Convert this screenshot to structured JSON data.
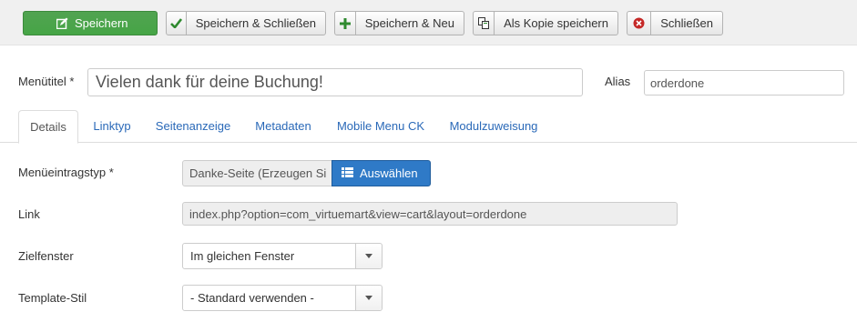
{
  "toolbar": {
    "save_label": "Speichern",
    "save_close_label": "Speichern & Schließen",
    "save_new_label": "Speichern & Neu",
    "save_copy_label": "Als Kopie speichern",
    "close_label": "Schließen",
    "icons": {
      "save": "edit-icon",
      "save_close": "check-icon",
      "save_new": "plus-icon",
      "save_copy": "copy-icon",
      "close": "cancel-icon"
    },
    "colors": {
      "primary": "#46a546",
      "close_icon": "#c52827",
      "check_icon": "#2f8a2f"
    }
  },
  "form": {
    "title_label": "Menütitel *",
    "title_value": "Vielen dank für deine Buchung!",
    "alias_label": "Alias",
    "alias_value": "orderdone"
  },
  "tabs": [
    {
      "label": "Details",
      "active": true
    },
    {
      "label": "Linktyp"
    },
    {
      "label": "Seitenanzeige"
    },
    {
      "label": "Metadaten"
    },
    {
      "label": "Mobile Menu CK"
    },
    {
      "label": "Modulzuweisung"
    }
  ],
  "details": {
    "menu_type_label": "Menüeintragstyp *",
    "menu_type_value": "Danke-Seite (Erzeugen Si",
    "select_button_label": "Auswählen",
    "link_label": "Link",
    "link_value": "index.php?option=com_virtuemart&view=cart&layout=orderdone",
    "target_label": "Zielfenster",
    "target_value": "Im gleichen Fenster",
    "template_label": "Template-Stil",
    "template_value": "- Standard verwenden -"
  },
  "colors": {
    "link": "#2a69b8",
    "select_button": "#2f7ac7"
  }
}
